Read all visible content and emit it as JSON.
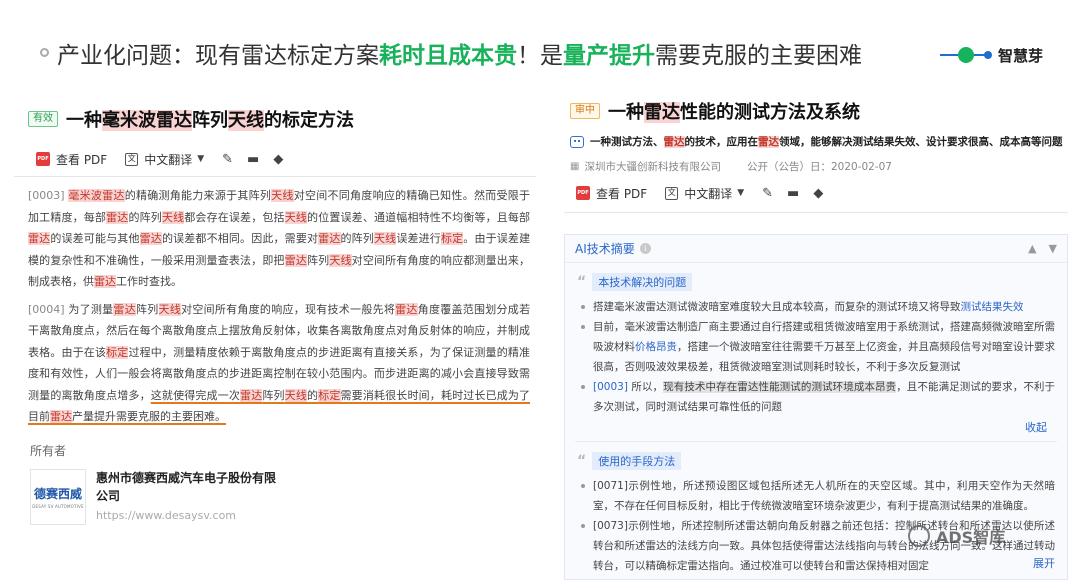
{
  "slide": {
    "title_part1": "产业化问题：现有雷达标定方案",
    "title_green1": "耗时且成本贵",
    "title_part2": "！是",
    "title_green2": "量产提升",
    "title_part3": "需要克服的主要困难",
    "brand": "智慧芽"
  },
  "left_doc": {
    "badge": "有效",
    "title_pre": "一种",
    "title_hl1": "毫米波雷达",
    "title_mid": "阵列",
    "title_hl2": "天线",
    "title_post": "的标定方法",
    "toolbar": {
      "pdf": "查看 PDF",
      "translate": "中文翻译"
    },
    "para1": {
      "num": "[0003]",
      "s1": "毫米波雷达",
      "s2": "的精确测角能力来源于其阵列",
      "s3": "天线",
      "s4": "对空间不同角度响应的精确已知性。然而受限于加工精度，每部",
      "s5": "雷达",
      "s6": "的阵列",
      "s7": "天线",
      "s8": "都会存在误差，包括",
      "s9": "天线",
      "s10": "的位置误差、通道幅相特性不均衡等，且每部",
      "s11": "雷达",
      "s12": "的误差可能与其他",
      "s13": "雷达",
      "s14": "的误差都不相同。因此，需要对",
      "s15": "雷达",
      "s16": "的阵列",
      "s17": "天线",
      "s18": "误差进行",
      "s19": "标定",
      "s20": "。由于误差建模的复杂性和不准确性，一般采用测量查表法，即把",
      "s21": "雷达",
      "s22": "阵列",
      "s23": "天线",
      "s24": "对空间所有角度的响应都测量出来，制成表格，供",
      "s25": "雷达",
      "s26": "工作时查找。"
    },
    "para2": {
      "num": "[0004]",
      "s1": "为了测量",
      "s2": "雷达",
      "s3": "阵列",
      "s4": "天线",
      "s5": "对空间所有角度的响应，现有技术一般先将",
      "s6": "雷达",
      "s7": "角度覆盖范围划分成若干离散角度点，然后在每个离散角度点上摆放角反射体，收集各离散角度点对角反射体的响应，并制成表格。由于在该",
      "s8": "标定",
      "s9": "过程中，测量精度依赖于离散角度点的步进距离有直接关系，为了保证测量的精准度和有效性，人们一般会将离散角度点的步进距离控制在较小范围内。而步进距离的减小会直接导致需测量的离散角度点增多，",
      "s10": "这就使得完成一次",
      "s11": "雷达",
      "s12": "阵列",
      "s13": "天线",
      "s14": "的",
      "s15": "标定",
      "s16": "需要消耗很长时间，耗时过长已成为了目前",
      "s17": "雷达",
      "s18": "产量提升需要克服的主要困难。"
    },
    "owner": {
      "label": "所有者",
      "logo_cn": "德赛西威",
      "logo_en": "DESAY SV AUTOMOTIVE",
      "name": "惠州市德赛西威汽车电子股份有限公司",
      "url": "https://www.desaysv.com"
    }
  },
  "right_doc": {
    "badge": "审中",
    "title_pre": "一种",
    "title_hl": "雷达",
    "title_post": "性能的测试方法及系统",
    "summary": {
      "s1": "一种测试方法、",
      "s2": "雷达",
      "s3": "的技术，应用在",
      "s4": "雷达",
      "s5": "领域，能够解决测试结果失效、设计要求很高、成本高等问题"
    },
    "applicant": "深圳市大疆创新科技有限公司",
    "pub_label": "公开（公告）日：",
    "pub_date": "2020-02-07",
    "toolbar": {
      "pdf": "查看 PDF",
      "translate": "中文翻译"
    },
    "ai": {
      "title": "AI技术摘要",
      "sec1_label": "本技术解决的问题",
      "b1_text": "搭建毫米波雷达测试微波暗室难度较大且成本较高，而复杂的测试环境又将导致",
      "b1_link": "测试结果失效",
      "b2_a": "目前，毫米波雷达制造厂商主要通过自行搭建或租赁微波暗室用于系统测试，搭建高频微波暗室所需吸波材料",
      "b2_link": "价格昂贵",
      "b2_b": "，搭建一个微波暗室往往需要千万甚至上亿资金，并且高频段信号对暗室设计要求很高，否则吸波效果极差，租赁微波暗室测试则耗时较长，不利于多次反复测试",
      "b3_num": "[0003]",
      "b3_a": "所以，",
      "b3_hl": "现有技术中存在雷达性能测试的测试环境成本昂贵",
      "b3_b": "，且不能满足测试的要求，不利于多次测试，同时测试结果可靠性低的问题",
      "collapse": "收起",
      "sec2_label": "使用的手段方法",
      "c1": "[0071]示例性地，所述预设图区域包括所述无人机所在的天空区域。其中，利用天空作为天然暗室，不存在任何目标反射，相比于传统微波暗室环境杂波更少，有利于提高测试结果的准确度。",
      "c2": "[0073]示例性地，所述控制所述雷达朝向角反射器之前还包括：控制所述转台和所述雷达以使所述转台和所述雷达的法线方向一致。具体包括使得雷达法线指向与转台的法线方向一致。这样通过转动转台，可以精确标定雷达指向。通过校准可以使转台和雷达保持相对固定",
      "expand": "展开"
    }
  },
  "watermark": "ADS智库"
}
